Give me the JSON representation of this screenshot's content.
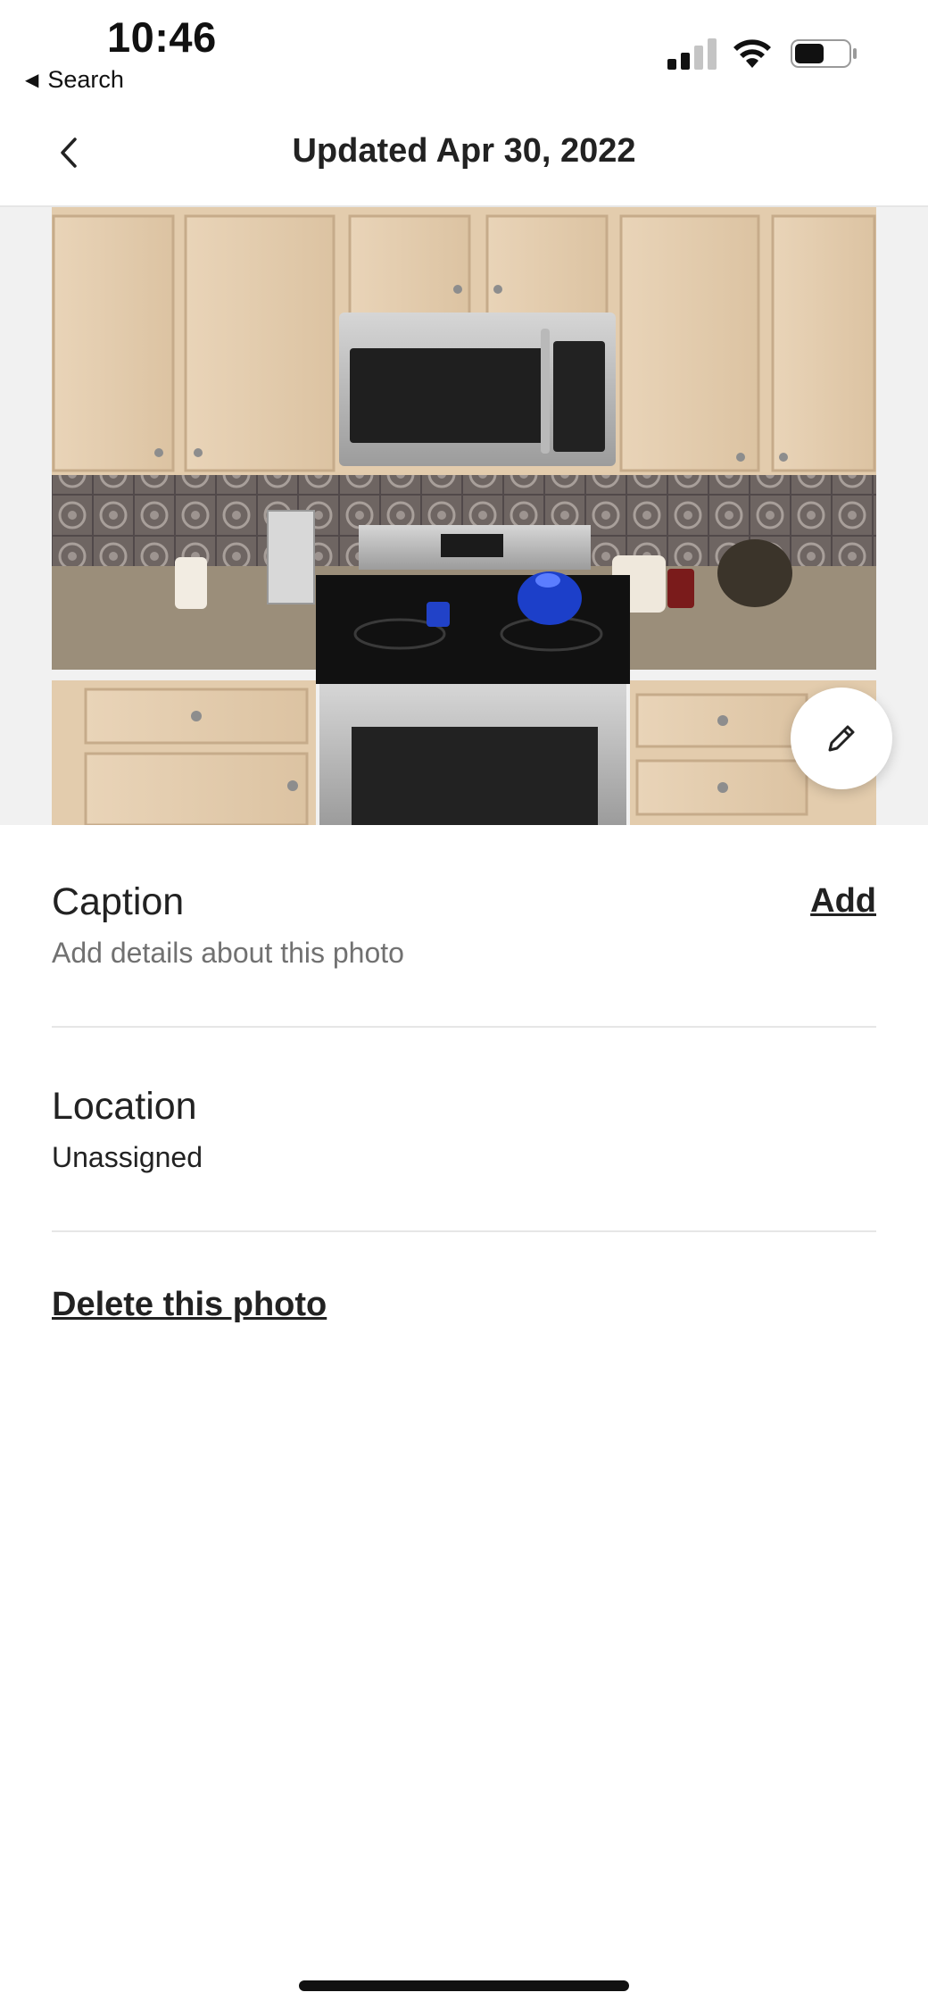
{
  "status_bar": {
    "time": "10:46",
    "back_label": "Search",
    "back_icon": "triangle-left-icon",
    "signal_icon": "cellular-signal-icon",
    "wifi_icon": "wifi-icon",
    "battery_icon": "battery-icon",
    "battery_level": 0.55
  },
  "header": {
    "title": "Updated Apr 30, 2022",
    "back_icon": "chevron-left-icon"
  },
  "photo": {
    "subject": "kitchen-photo",
    "edit_icon": "pencil-icon"
  },
  "caption": {
    "label": "Caption",
    "placeholder": "Add details about this photo",
    "action_label": "Add"
  },
  "location": {
    "label": "Location",
    "value": "Unassigned"
  },
  "delete": {
    "label": "Delete this photo"
  },
  "colors": {
    "text_primary": "#222222",
    "text_secondary": "#717171",
    "divider": "#e6e6e6",
    "photo_backdrop": "#f1f1f1"
  }
}
